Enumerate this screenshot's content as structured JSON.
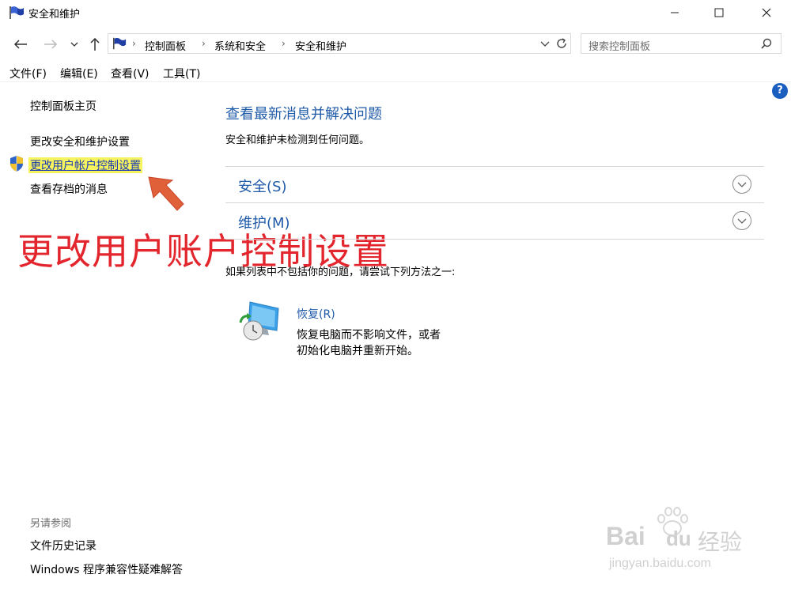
{
  "window": {
    "title": "安全和维护",
    "minimize_icon": "minimize-icon",
    "maximize_icon": "maximize-icon",
    "close_icon": "close-icon"
  },
  "address_bar": {
    "breadcrumbs": [
      "控制面板",
      "系统和安全",
      "安全和维护"
    ],
    "search_placeholder": "搜索控制面板"
  },
  "menu": [
    "文件(F)",
    "编辑(E)",
    "查看(V)",
    "工具(T)"
  ],
  "sidebar": {
    "home": "控制面板主页",
    "items": [
      "更改安全和维护设置",
      "更改用户帐户控制设置",
      "查看存档的消息"
    ],
    "see_also_title": "另请参阅",
    "see_also": [
      "文件历史记录",
      "Windows 程序兼容性疑难解答"
    ]
  },
  "main": {
    "heading": "查看最新消息并解决问题",
    "status": "安全和维护未检测到任何问题。",
    "sections": [
      "安全(S)",
      "维护(M)"
    ],
    "hint": "如果列表中不包括你的问题，请尝试下列方法之一:",
    "recovery": {
      "title": "恢复(R)",
      "line1": "恢复电脑而不影响文件，或者",
      "line2": "初始化电脑并重新开始。"
    }
  },
  "annotation": {
    "text": "更改用户账户控制设置",
    "color": "#e3262d"
  },
  "watermark": {
    "brand": "Bai",
    "brand2": "du",
    "suffix": "经验",
    "url": "jingyan.baidu.com"
  },
  "colors": {
    "link_blue": "#1e5aa8",
    "highlight": "#f7f35f"
  }
}
